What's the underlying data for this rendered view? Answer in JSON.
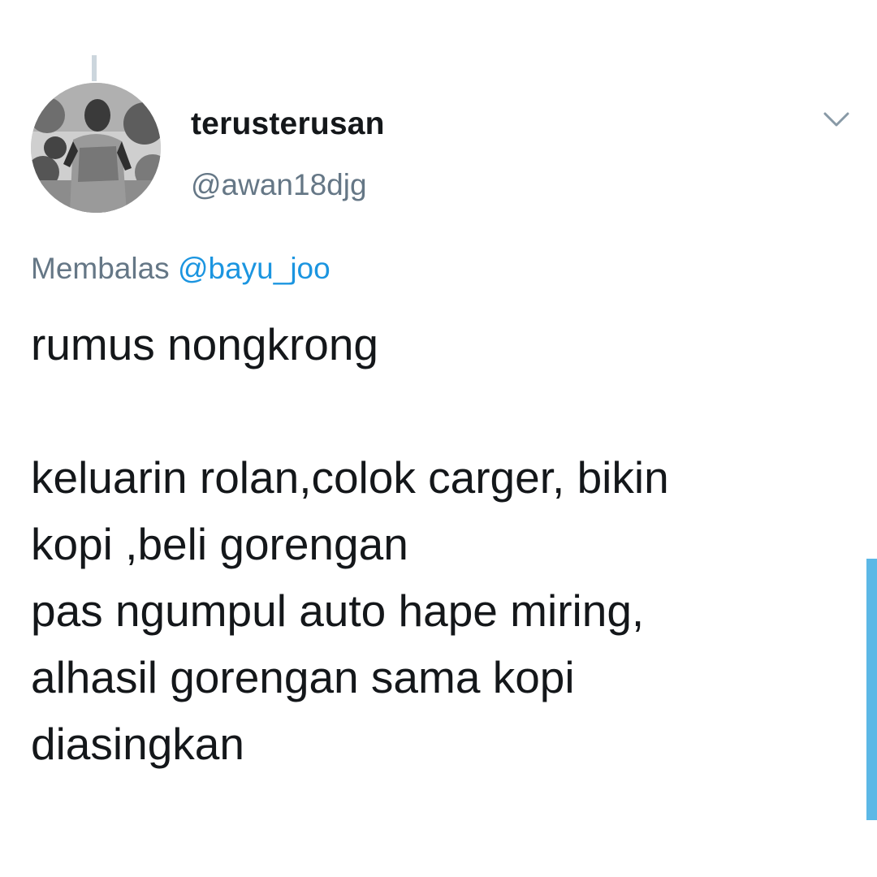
{
  "tweet": {
    "author": {
      "display_name": "terusterusan",
      "handle": "@awan18djg",
      "avatar": "profile-photo"
    },
    "reply": {
      "prefix": "Membalas",
      "to_handle": "@bayu_joo"
    },
    "text": "rumus nongkrong\n\nkeluarin rolan,colok  carger,  bikin\nkopi ,beli gorengan\npas ngumpul auto hape miring,\nalhasil gorengan sama kopi\ndiasingkan",
    "menu_icon": "chevron-down-icon"
  },
  "colors": {
    "text_primary": "#14171a",
    "text_secondary": "#657786",
    "link": "#1b95e0",
    "scroll_indicator": "#5cb8e6",
    "thread_line": "#ccd6dd"
  }
}
